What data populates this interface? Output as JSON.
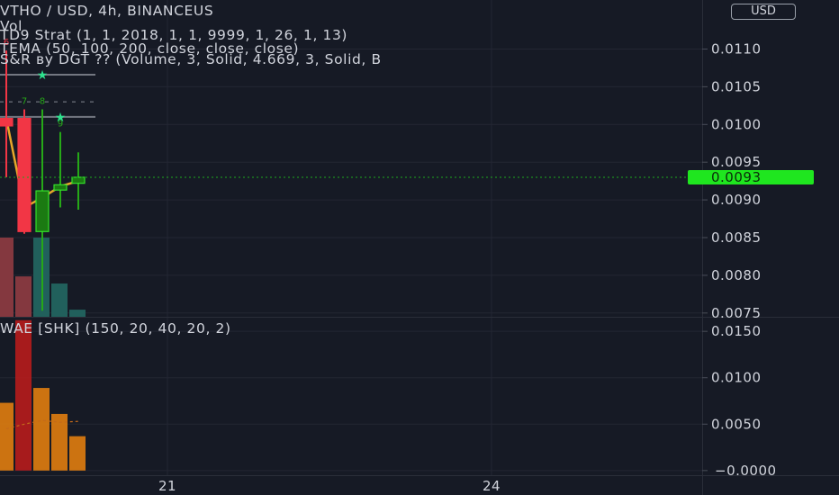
{
  "legend": {
    "title": "VTHO / USD, 4h, BINANCEUS",
    "vol": "Vol",
    "td9": "TD9 Strat (1, 1, 2018, 1, 1, 9999, 1, 26, 1, 13)",
    "tema": "TEMA (50, 100, 200, close, close, close)",
    "sr": "S&R вy DGT ?? (Volume, 3, Solid, 4.669, 3, Solid, B",
    "wae": "WAE [SHK] (150, 20, 40, 20, 2)"
  },
  "currency_button": "USD",
  "colors": {
    "background": "#161a25",
    "grid": "#232633",
    "up": "#089981",
    "up_body": "#26a818",
    "down": "#f23645",
    "price_tag": "#1fe61f",
    "text": "#d1d4dc",
    "wae_orange": "#e07d10",
    "wae_red": "#b71c1c",
    "tema": "#e6a72a",
    "sr_line": "#b2b5be"
  },
  "chart_data": [
    {
      "type": "candlestick",
      "title": "VTHO / USD, 4h, BINANCEUS",
      "x_tick_labels": [
        "21",
        "24"
      ],
      "y_ticks": [
        "0.0075",
        "0.0080",
        "0.0085",
        "0.0090",
        "0.0095",
        "0.0100",
        "0.0105",
        "0.0110"
      ],
      "ylim": [
        0.00745,
        0.01165
      ],
      "last_price": 0.0093,
      "last_price_label": "0.0093",
      "candles": [
        {
          "open": 0.01008,
          "high": 0.01098,
          "low": 0.0093,
          "close": 0.00998
        },
        {
          "open": 0.01008,
          "high": 0.0102,
          "low": 0.00855,
          "close": 0.00858
        },
        {
          "open": 0.00858,
          "high": 0.0102,
          "low": 0.00753,
          "close": 0.00912
        },
        {
          "open": 0.00913,
          "high": 0.0099,
          "low": 0.0089,
          "close": 0.0092
        },
        {
          "open": 0.00922,
          "high": 0.00963,
          "low": 0.00887,
          "close": 0.0093
        }
      ],
      "volume": [
        {
          "value": 1.0,
          "direction": "down"
        },
        {
          "value": 0.51,
          "direction": "down"
        },
        {
          "value": 1.0,
          "direction": "up"
        },
        {
          "value": 0.42,
          "direction": "up"
        },
        {
          "value": 0.09,
          "direction": "up"
        }
      ],
      "td9_labels": [
        {
          "candle": 0,
          "text": "6"
        },
        {
          "candle": 1,
          "text": "7"
        },
        {
          "candle": 2,
          "text": "8"
        },
        {
          "candle": 3,
          "text": "9"
        }
      ],
      "sr_levels": [
        0.01066,
        0.0101
      ],
      "tema": [
        0.01008,
        0.0089,
        0.00903,
        0.00918,
        0.00925
      ]
    },
    {
      "type": "bar",
      "title": "WAE [SHK] (150, 20, 40, 20, 2)",
      "y_ticks": [
        "−0.0000",
        "0.0050",
        "0.0100",
        "0.0150"
      ],
      "ylim": [
        -0.0005,
        0.0155
      ],
      "values": [
        0.0073,
        0.0162,
        0.0089,
        0.0061,
        0.0037
      ],
      "colors": [
        "orange",
        "red",
        "orange",
        "orange",
        "orange"
      ],
      "explosion_line": [
        0.0045,
        0.005,
        0.0054,
        0.0052,
        0.0053
      ]
    }
  ]
}
